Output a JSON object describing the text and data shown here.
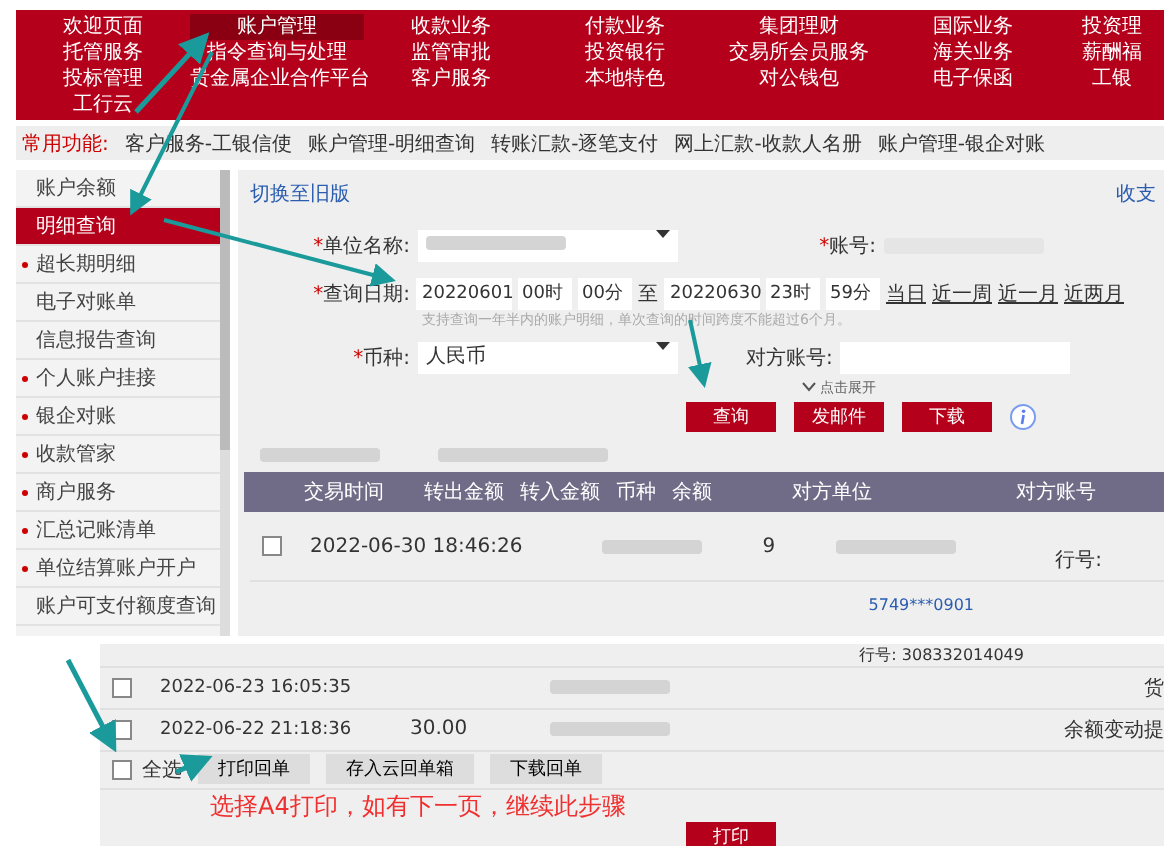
{
  "nav": {
    "items": [
      {
        "label": "欢迎页面",
        "selected": false
      },
      {
        "label": "账户管理",
        "selected": true
      },
      {
        "label": "收款业务",
        "selected": false
      },
      {
        "label": "付款业务",
        "selected": false
      },
      {
        "label": "集团理财",
        "selected": false
      },
      {
        "label": "国际业务",
        "selected": false
      },
      {
        "label": "投资理",
        "selected": false
      },
      {
        "label": "托管服务",
        "selected": false
      },
      {
        "label": "指令查询与处理",
        "selected": false
      },
      {
        "label": "监管审批",
        "selected": false
      },
      {
        "label": "投资银行",
        "selected": false
      },
      {
        "label": "交易所会员服务",
        "selected": false
      },
      {
        "label": "海关业务",
        "selected": false
      },
      {
        "label": "薪酬福",
        "selected": false
      },
      {
        "label": "投标管理",
        "selected": false
      },
      {
        "label": "贵金属企业合作平台",
        "selected": false
      },
      {
        "label": "客户服务",
        "selected": false
      },
      {
        "label": "本地特色",
        "selected": false
      },
      {
        "label": "对公钱包",
        "selected": false
      },
      {
        "label": "电子保函",
        "selected": false
      },
      {
        "label": "工银",
        "selected": false
      },
      {
        "label": "工行云",
        "selected": false
      }
    ]
  },
  "quick_bar": {
    "label": "常用功能:",
    "links": [
      "客户服务-工银信使",
      "账户管理-明细查询",
      "转账汇款-逐笔支付",
      "网上汇款-收款人名册",
      "账户管理-银企对账"
    ]
  },
  "sidebar": {
    "items": [
      {
        "label": "账户余额",
        "selected": false,
        "bullet": false
      },
      {
        "label": "明细查询",
        "selected": true,
        "bullet": false
      },
      {
        "label": "超长期明细",
        "selected": false,
        "bullet": true
      },
      {
        "label": "电子对账单",
        "selected": false,
        "bullet": false
      },
      {
        "label": "信息报告查询",
        "selected": false,
        "bullet": false
      },
      {
        "label": "个人账户挂接",
        "selected": false,
        "bullet": true
      },
      {
        "label": "银企对账",
        "selected": false,
        "bullet": true
      },
      {
        "label": "收款管家",
        "selected": false,
        "bullet": true
      },
      {
        "label": "商户服务",
        "selected": false,
        "bullet": true
      },
      {
        "label": "汇总记账清单",
        "selected": false,
        "bullet": true
      },
      {
        "label": "单位结算账户开户",
        "selected": false,
        "bullet": true
      },
      {
        "label": "账户可支付额度查询",
        "selected": false,
        "bullet": false
      }
    ]
  },
  "main": {
    "switch_link": "切换至旧版",
    "type_label": "收支",
    "unit_mark": "*",
    "unit_label": "单位名称:",
    "account_mark": "*",
    "account_label": "账号:",
    "date_mark": "*",
    "date_label": "查询日期:",
    "start_date": "20220601",
    "start_hour": "00时",
    "start_minute": "00分",
    "date_separator": "至",
    "end_date": "20220630",
    "end_hour": "23时",
    "end_minute": "59分",
    "quick_ranges": [
      "当日",
      "近一周",
      "近一月",
      "近两月"
    ],
    "hint": "支持查询一年半内的账户明细，单次查询的时间跨度不能超过6个月。",
    "currency_mark": "*",
    "currency_label": "币种:",
    "currency_value": "人民币",
    "counter_account_label": "对方账号:",
    "expand_label": "点击展开",
    "buttons": [
      "查询",
      "发邮件",
      "下载"
    ]
  },
  "table": {
    "columns": [
      "交易时间",
      "转出金额",
      "转入金额",
      "币种",
      "余额",
      "对方单位",
      "对方账号"
    ],
    "rows": [
      {
        "checked": false,
        "time": "2022-06-30  18:46:26",
        "balance_tail": "9",
        "bank_label": "行号:"
      }
    ],
    "partial_account": "5749***0901"
  },
  "lower": {
    "bank_line": "行号: 308332014049",
    "rows": [
      {
        "checked": false,
        "time": "2022-06-23  16:05:35",
        "note": "货"
      },
      {
        "checked": false,
        "time": "2022-06-22  21:18:36",
        "amount": "30.00",
        "note": "余额变动提"
      }
    ],
    "select_all": "全选",
    "select_all_checked": false,
    "actions": [
      "打印回单",
      "存入云回单箱",
      "下载回单"
    ],
    "annotation_text": "选择A4打印，如有下一页，继续此步骤",
    "print_button": "打印"
  }
}
